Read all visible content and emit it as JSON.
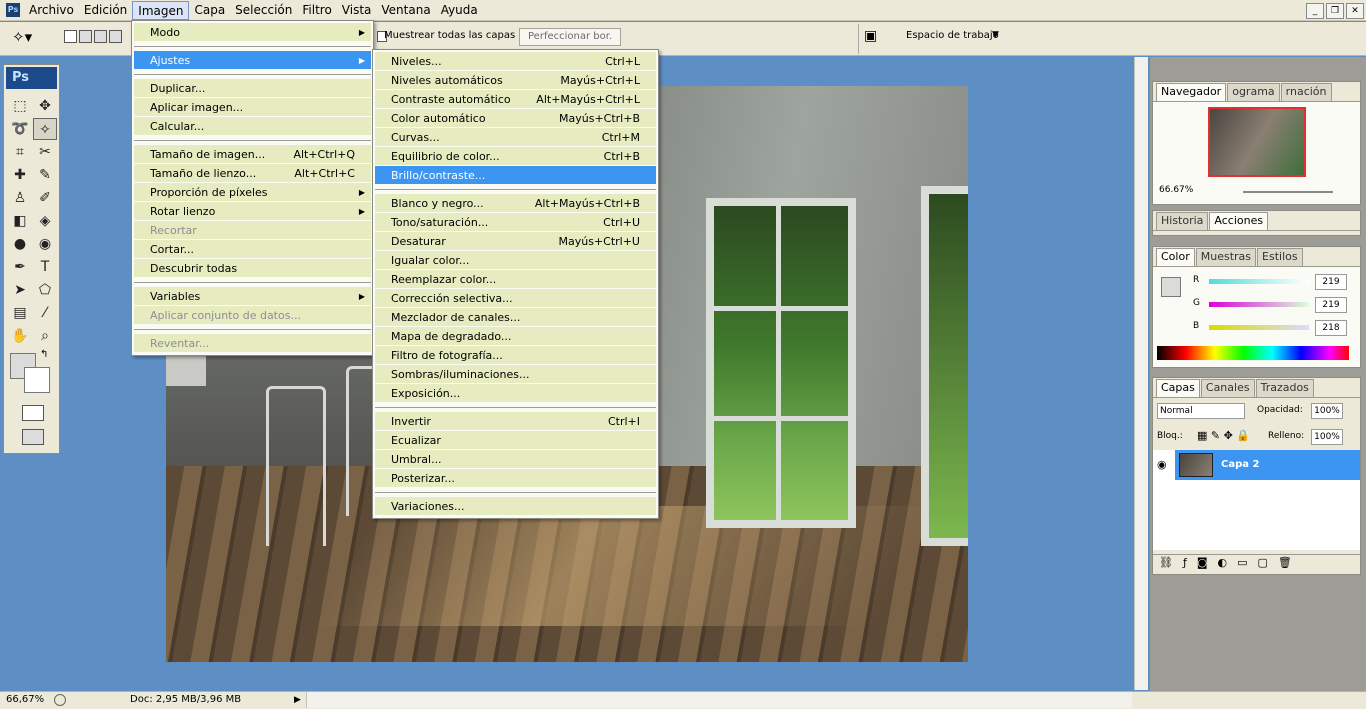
{
  "app": {
    "logo": "Ps"
  },
  "menubar": {
    "items": [
      "Archivo",
      "Edición",
      "Imagen",
      "Capa",
      "Selección",
      "Filtro",
      "Vista",
      "Ventana",
      "Ayuda"
    ]
  },
  "options": {
    "sample_all_layers": "Muestrear todas las capas",
    "refine_edge": "Perfeccionar bor.",
    "workspace": "Espacio de trabajo"
  },
  "imagen_menu": [
    {
      "label": "Modo",
      "submenu": true
    },
    {
      "sep": true
    },
    {
      "label": "Ajustes",
      "submenu": true,
      "highlight": true
    },
    {
      "sep": true
    },
    {
      "label": "Duplicar..."
    },
    {
      "label": "Aplicar imagen..."
    },
    {
      "label": "Calcular..."
    },
    {
      "sep": true
    },
    {
      "label": "Tamaño de imagen...",
      "shortcut": "Alt+Ctrl+Q"
    },
    {
      "label": "Tamaño de lienzo...",
      "shortcut": "Alt+Ctrl+C"
    },
    {
      "label": "Proporción de píxeles",
      "submenu": true
    },
    {
      "label": "Rotar lienzo",
      "submenu": true
    },
    {
      "label": "Recortar",
      "disabled": true
    },
    {
      "label": "Cortar..."
    },
    {
      "label": "Descubrir todas"
    },
    {
      "sep": true
    },
    {
      "label": "Variables",
      "submenu": true
    },
    {
      "label": "Aplicar conjunto de datos...",
      "disabled": true
    },
    {
      "sep": true
    },
    {
      "label": "Reventar...",
      "disabled": true
    }
  ],
  "ajustes_menu": [
    {
      "label": "Niveles...",
      "shortcut": "Ctrl+L"
    },
    {
      "label": "Niveles automáticos",
      "shortcut": "Mayús+Ctrl+L"
    },
    {
      "label": "Contraste automático",
      "shortcut": "Alt+Mayús+Ctrl+L"
    },
    {
      "label": "Color automático",
      "shortcut": "Mayús+Ctrl+B"
    },
    {
      "label": "Curvas...",
      "shortcut": "Ctrl+M"
    },
    {
      "label": "Equilibrio de color...",
      "shortcut": "Ctrl+B"
    },
    {
      "label": "Brillo/contraste...",
      "highlight": true
    },
    {
      "sep": true
    },
    {
      "label": "Blanco y negro...",
      "shortcut": "Alt+Mayús+Ctrl+B"
    },
    {
      "label": "Tono/saturación...",
      "shortcut": "Ctrl+U"
    },
    {
      "label": "Desaturar",
      "shortcut": "Mayús+Ctrl+U"
    },
    {
      "label": "Igualar color..."
    },
    {
      "label": "Reemplazar color..."
    },
    {
      "label": "Corrección selectiva..."
    },
    {
      "label": "Mezclador de canales..."
    },
    {
      "label": "Mapa de degradado..."
    },
    {
      "label": "Filtro de fotografía..."
    },
    {
      "label": "Sombras/iluminaciones..."
    },
    {
      "label": "Exposición..."
    },
    {
      "sep": true
    },
    {
      "label": "Invertir",
      "shortcut": "Ctrl+I"
    },
    {
      "label": "Ecualizar"
    },
    {
      "label": "Umbral..."
    },
    {
      "label": "Posterizar..."
    },
    {
      "sep": true
    },
    {
      "label": "Variaciones..."
    }
  ],
  "navigator": {
    "tabs": [
      "Navegador",
      "ograma",
      "rnación"
    ],
    "zoom": "66.67%"
  },
  "history": {
    "tabs": [
      "Historia",
      "Acciones"
    ]
  },
  "color": {
    "tabs": [
      "Color",
      "Muestras",
      "Estilos"
    ],
    "r_label": "R",
    "g_label": "G",
    "b_label": "B",
    "r": "219",
    "g": "219",
    "b": "218"
  },
  "layers": {
    "tabs": [
      "Capas",
      "Canales",
      "Trazados"
    ],
    "blend": "Normal",
    "opacity_label": "Opacidad:",
    "opacity": "100%",
    "lock_label": "Bloq.:",
    "fill_label": "Relleno:",
    "fill": "100%",
    "layer_name": "Capa 2"
  },
  "status": {
    "zoom": "66,67%",
    "doc": "Doc: 2,95 MB/3,96 MB"
  }
}
